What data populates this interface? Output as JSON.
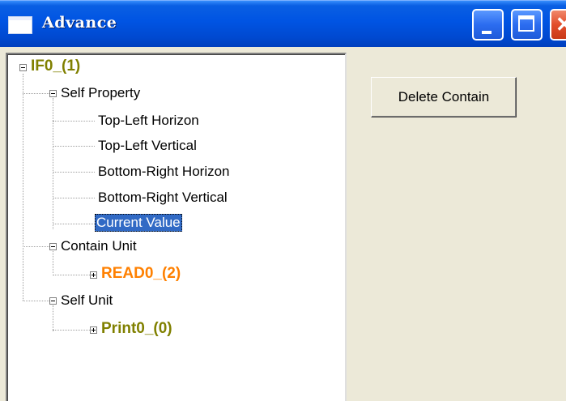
{
  "window": {
    "title": "Advance",
    "icon": "window-icon"
  },
  "tree": {
    "root": {
      "label": "IF0_(1)",
      "expanded": true,
      "color": "#808000"
    },
    "self_property": {
      "label": "Self Property",
      "expanded": true,
      "items": [
        {
          "label": "Top-Left Horizon"
        },
        {
          "label": "Top-Left Vertical"
        },
        {
          "label": "Bottom-Right Horizon"
        },
        {
          "label": "Bottom-Right Vertical"
        },
        {
          "label": "Current Value",
          "selected": true
        }
      ]
    },
    "contain_unit": {
      "label": "Contain Unit",
      "expanded": true,
      "child": {
        "label": "READ0_(2)",
        "expanded": false,
        "color": "#ff8000"
      }
    },
    "self_unit": {
      "label": "Self Unit",
      "expanded": true,
      "child": {
        "label": "Print0_(0)",
        "expanded": false,
        "color": "#808000"
      }
    }
  },
  "actions": {
    "delete_label": "Delete Contain"
  },
  "colors": {
    "titlebar": "#0054e3",
    "selection": "#316ac5",
    "dialog_bg": "#ece9d8"
  }
}
